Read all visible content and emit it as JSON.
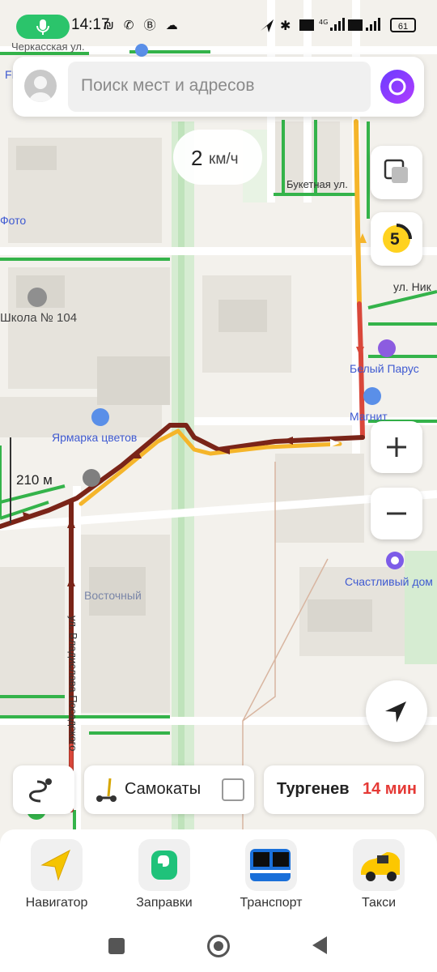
{
  "status": {
    "time": "14:17",
    "icons_left": "₪ ✆ Ⓑ ☁",
    "net_4g": "4G",
    "battery": "61"
  },
  "search": {
    "placeholder": "Поиск мест и адресов"
  },
  "speed": {
    "value": "2",
    "unit": "км/ч"
  },
  "traffic_level": "5",
  "map_labels": {
    "cherkasskaya": "Черкасская ул.",
    "foto": "Фото",
    "school": "Школа № 104",
    "buketnaya": "Букетная ул.",
    "ul_nik": "ул. Ник",
    "bely_parus": "Белый Парус",
    "magnit": "Магнит",
    "yarmarka": "Ярмарка цветов",
    "schastlivy": "Счастливый дом",
    "vostochny": "Восточный",
    "vladislava": "ул. Владислава Посадского",
    "p_fi": "FI P"
  },
  "scale": "210 м",
  "chips": {
    "scooters": "Самокаты",
    "eta_place": "Тургенев",
    "eta_time": "14 мин"
  },
  "services": [
    {
      "label": "Навигатор",
      "icon": "navigator-icon"
    },
    {
      "label": "Заправки",
      "icon": "fuel-icon"
    },
    {
      "label": "Транспорт",
      "icon": "bus-icon"
    },
    {
      "label": "Такси",
      "icon": "taxi-icon"
    }
  ],
  "colors": {
    "accent_green": "#2bc46b",
    "traffic_red": "#d9473a",
    "traffic_darkred": "#7a2418",
    "traffic_yellow": "#f5b52a",
    "free_green": "#34b34a",
    "eta_red": "#e53935"
  }
}
